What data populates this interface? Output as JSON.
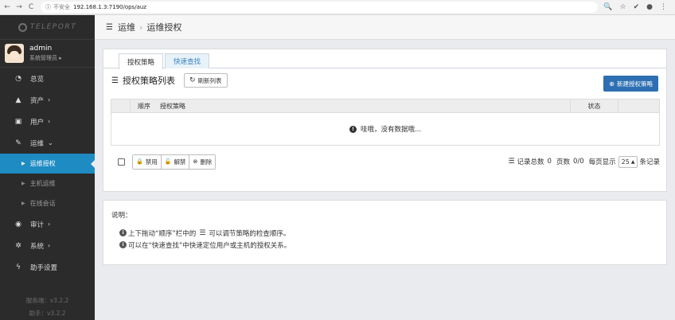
{
  "browser": {
    "security_label": "不安全",
    "url": "192.168.1.3:7190/ops/auz"
  },
  "sidebar": {
    "logo_text": "TELEPORT",
    "user": {
      "name": "admin",
      "role": "系统管理员"
    },
    "items": [
      {
        "label": "总览",
        "icon": "dashboard-icon"
      },
      {
        "label": "资产",
        "icon": "cubes-icon"
      },
      {
        "label": "用户",
        "icon": "address-card-icon"
      },
      {
        "label": "运维",
        "icon": "wrench-icon"
      },
      {
        "label": "审计",
        "icon": "eye-icon"
      },
      {
        "label": "系统",
        "icon": "gear-icon"
      },
      {
        "label": "助手设置",
        "icon": "bolt-icon"
      }
    ],
    "ops_sub": [
      {
        "label": "运维授权"
      },
      {
        "label": "主机运维"
      },
      {
        "label": "在线会话"
      }
    ],
    "server_version": "服务端：v3.2.2",
    "assist_version": "助手：v3.2.2"
  },
  "breadcrumb": {
    "root": "运维",
    "current": "运维授权"
  },
  "tabs": [
    {
      "label": "授权策略"
    },
    {
      "label": "快速查找"
    }
  ],
  "list": {
    "title": "授权策略列表",
    "refresh_label": "刷新列表",
    "new_label": "新建授权策略",
    "columns": {
      "order": "顺序",
      "policy": "授权策略",
      "status": "状态"
    },
    "empty_text": "哇哦，没有数据哦..."
  },
  "actions": {
    "disable": "禁用",
    "enable": "解禁",
    "delete": "删除"
  },
  "pager": {
    "total_label": "记录总数",
    "total": "0",
    "pages_label": "页数",
    "pages": "0/0",
    "per_page_label": "每页显示",
    "page_size": "25",
    "unit_label": "条记录"
  },
  "notes": {
    "title": "说明：",
    "line1_a": "上下拖动“顺序”栏中的",
    "line1_b": "可以调节策略的检查顺序。",
    "line2": "可以在“快速查找”中快速定位用户或主机的授权关系。"
  },
  "colors": {
    "accent": "#1e8bc3",
    "primary_button": "#2d6fb2",
    "sidebar_bg": "#2b2b2b"
  }
}
